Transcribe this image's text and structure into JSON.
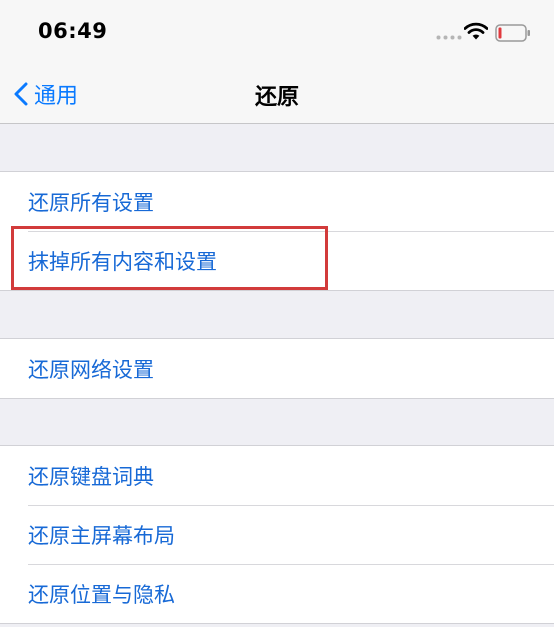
{
  "status_bar": {
    "time": "06:49",
    "battery_color": "#e0393e"
  },
  "nav": {
    "back_label": "通用",
    "title": "还原",
    "accent_color": "#0a7aff"
  },
  "groups": [
    {
      "items": [
        {
          "label": "还原所有设置"
        },
        {
          "label": "抹掉所有内容和设置"
        }
      ]
    },
    {
      "items": [
        {
          "label": "还原网络设置"
        }
      ]
    },
    {
      "items": [
        {
          "label": "还原键盘词典"
        },
        {
          "label": "还原主屏幕布局"
        },
        {
          "label": "还原位置与隐私"
        }
      ]
    }
  ],
  "annotation": {
    "highlight_color": "#d23b3b",
    "highlighted_item": "抹掉所有内容和设置"
  }
}
